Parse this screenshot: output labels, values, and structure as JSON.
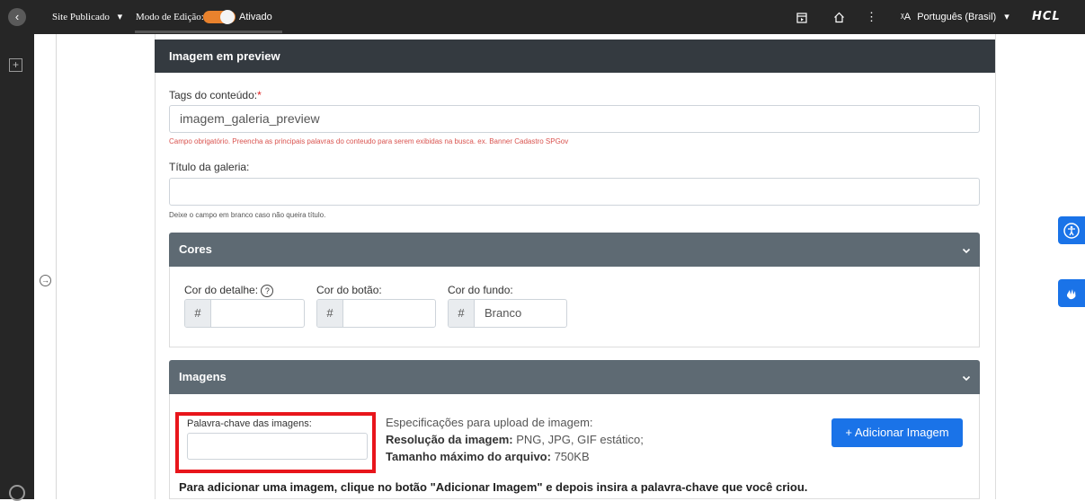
{
  "topbar": {
    "site_status": "Site Publicado",
    "edit_mode_label": "Modo de Edição:",
    "edit_mode_value": "Ativado",
    "language": "Português (Brasil)",
    "brand": "HCL",
    "dropdown_glyph": "▾",
    "translate_glyph": "ᵡA"
  },
  "panel": {
    "header": "Imagem em preview",
    "tags_label": "Tags do conteúdo:",
    "tags_required": "*",
    "tags_value": "imagem_galeria_preview",
    "tags_help": "Campo obrigatório. Preencha as principais palavras do conteudo para serem exibidas na busca. ex. Banner Cadastro SPGov",
    "title_label": "Título da galeria:",
    "title_value": "",
    "title_help": "Deixe o campo em branco caso não queira título."
  },
  "colors": {
    "header": "Cores",
    "detail_label": "Cor do detalhe:",
    "button_label": "Cor do botão:",
    "background_label": "Cor do fundo:",
    "prefix": "#",
    "detail_value": "",
    "button_value": "",
    "background_value": "Branco"
  },
  "images": {
    "header": "Imagens",
    "keyword_label": "Palavra-chave das imagens:",
    "keyword_value": "",
    "spec_title": "Especificações para upload de imagem:",
    "resolution_label": "Resolução da imagem:",
    "resolution_value": "PNG, JPG, GIF estático;",
    "max_size_label": "Tamanho máximo do arquivo:",
    "max_size_value": "750KB",
    "add_button": "+ Adicionar Imagem",
    "instruction": "Para adicionar uma imagem, clique no botão \"Adicionar Imagem\" e depois insira a palavra-chave que você criou."
  },
  "colors_meta": {
    "highlight": "#e8151b",
    "primary": "#1a73e8",
    "toggle": "#e9822d"
  }
}
